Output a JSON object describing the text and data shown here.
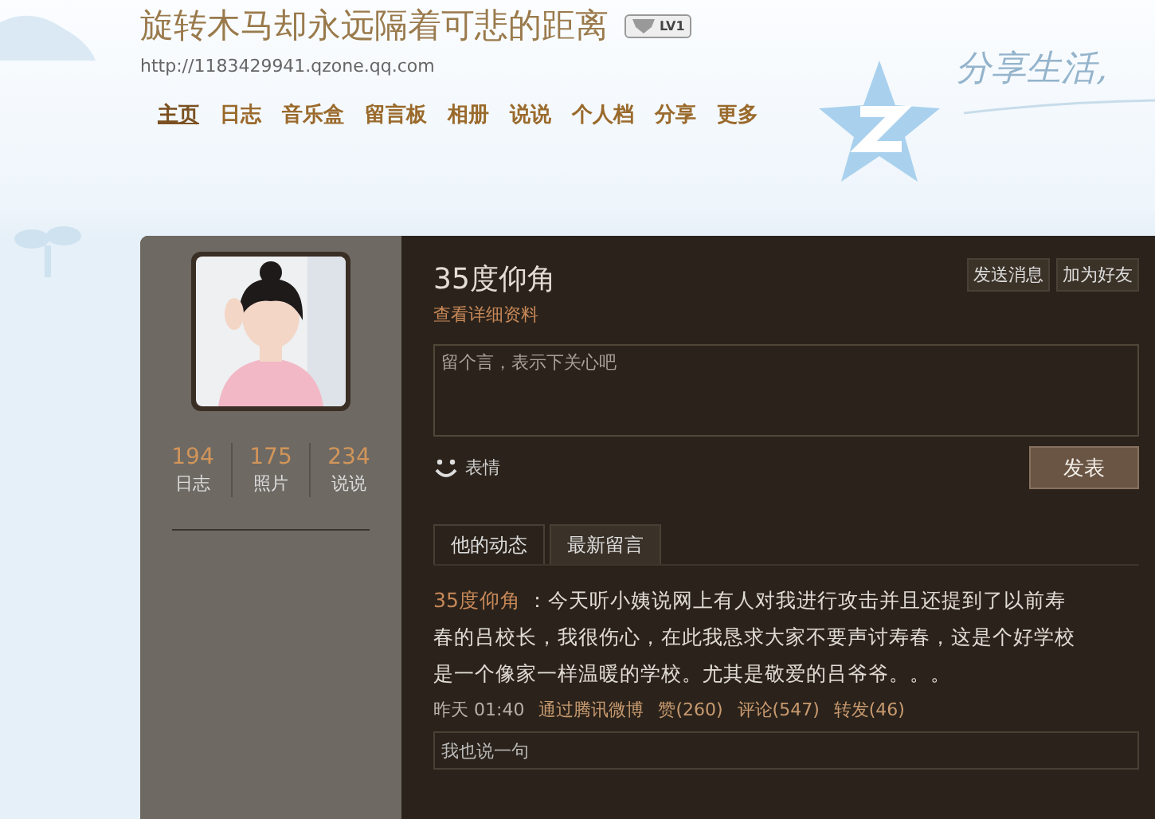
{
  "header": {
    "title": "旋转木马却永远隔着可悲的距离",
    "level_badge": "LV1",
    "url": "http://1183429941.qzone.qq.com",
    "slogan": "分享生活,"
  },
  "nav": [
    {
      "label": "主页",
      "selected": true
    },
    {
      "label": "日志",
      "selected": false
    },
    {
      "label": "音乐盒",
      "selected": false
    },
    {
      "label": "留言板",
      "selected": false
    },
    {
      "label": "相册",
      "selected": false
    },
    {
      "label": "说说",
      "selected": false
    },
    {
      "label": "个人档",
      "selected": false
    },
    {
      "label": "分享",
      "selected": false
    },
    {
      "label": "更多",
      "selected": false
    }
  ],
  "stats": [
    {
      "count": "194",
      "label": "日志"
    },
    {
      "count": "175",
      "label": "照片"
    },
    {
      "count": "234",
      "label": "说说"
    }
  ],
  "profile": {
    "name": "35度仰角",
    "details_link": "查看详细资料",
    "actions": [
      "发送消息",
      "加为好友"
    ]
  },
  "message_box": {
    "placeholder": "留个言，表示下关心吧",
    "emoji_label": "表情",
    "submit": "发表"
  },
  "tabs": [
    {
      "label": "他的动态",
      "selected": true
    },
    {
      "label": "最新留言",
      "selected": false
    }
  ],
  "post": {
    "author": "35度仰角",
    "text": "：今天听小姨说网上有人对我进行攻击并且还提到了以前寿春的吕校长，我很伤心，在此我恳求大家不要声讨寿春，这是个好学校是一个像家一样温暖的学校。尤其是敬爱的吕爷爷。。。",
    "time": "昨天 01:40",
    "source": "通过腾讯微博",
    "likes": "赞(260)",
    "comments": "评论(547)",
    "shares": "转发(46)",
    "reply_placeholder": "我也说一句"
  }
}
